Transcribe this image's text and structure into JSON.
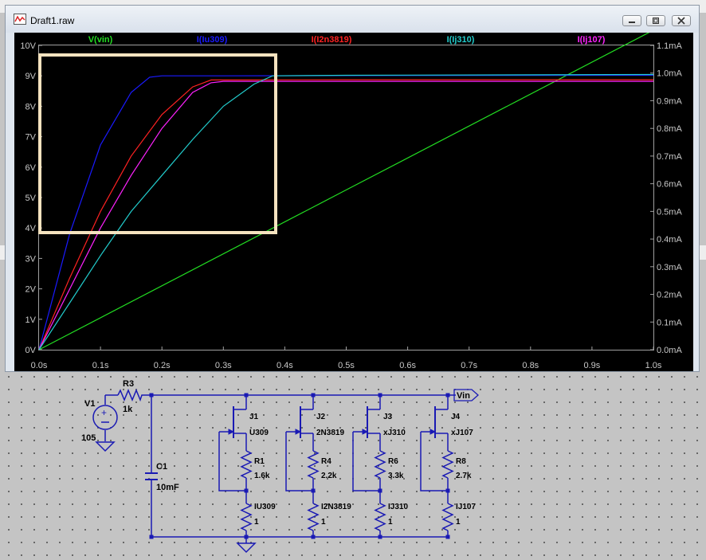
{
  "window": {
    "title": "Draft1.raw"
  },
  "plot": {
    "legend": [
      {
        "label": "V(vin)",
        "color": "#22dd22"
      },
      {
        "label": "I(Iu309)",
        "color": "#1a1aff"
      },
      {
        "label": "I(I2n3819)",
        "color": "#ff2222"
      },
      {
        "label": "I(Ij310)",
        "color": "#22cccc"
      },
      {
        "label": "I(Ij107)",
        "color": "#ff22ff"
      }
    ],
    "left_axis_ticks": [
      "0V",
      "1V",
      "2V",
      "3V",
      "4V",
      "5V",
      "6V",
      "7V",
      "8V",
      "9V",
      "10V"
    ],
    "right_axis_ticks": [
      "0.0mA",
      "0.1mA",
      "0.2mA",
      "0.3mA",
      "0.4mA",
      "0.5mA",
      "0.6mA",
      "0.7mA",
      "0.8mA",
      "0.9mA",
      "1.0mA",
      "1.1mA"
    ],
    "x_axis_ticks": [
      "0.0s",
      "0.1s",
      "0.2s",
      "0.3s",
      "0.4s",
      "0.5s",
      "0.6s",
      "0.7s",
      "0.8s",
      "0.9s",
      "1.0s"
    ],
    "highlight_color": "#f5e3bf"
  },
  "chart_data": {
    "type": "line",
    "x_unit": "s",
    "xlim": [
      0,
      1.0
    ],
    "left_ylim": [
      0,
      10
    ],
    "right_ylim": [
      0,
      1.1
    ],
    "grid": false,
    "legend_placement": "top",
    "series": [
      {
        "name": "V(vin)",
        "axis": "left",
        "color": "#22dd22",
        "x": [
          0,
          0.5,
          1.0
        ],
        "y": [
          0,
          5.25,
          10.5
        ]
      },
      {
        "name": "I(Iu309)",
        "axis": "right",
        "color": "#1a1aff",
        "x": [
          0,
          0.05,
          0.1,
          0.15,
          0.18,
          0.2,
          0.25,
          0.3,
          0.5,
          1.0
        ],
        "y": [
          0,
          0.42,
          0.74,
          0.93,
          0.985,
          0.99,
          0.99,
          0.99,
          0.991,
          0.992
        ]
      },
      {
        "name": "I(I2n3819)",
        "axis": "right",
        "color": "#ff2222",
        "x": [
          0,
          0.05,
          0.1,
          0.15,
          0.2,
          0.25,
          0.28,
          0.3,
          0.5,
          1.0
        ],
        "y": [
          0,
          0.26,
          0.5,
          0.7,
          0.85,
          0.95,
          0.975,
          0.975,
          0.976,
          0.976
        ]
      },
      {
        "name": "I(Ij107)",
        "axis": "right",
        "color": "#ff22ff",
        "x": [
          0,
          0.05,
          0.1,
          0.15,
          0.2,
          0.25,
          0.28,
          0.3,
          0.5,
          1.0
        ],
        "y": [
          0,
          0.22,
          0.44,
          0.63,
          0.8,
          0.93,
          0.965,
          0.97,
          0.97,
          0.97
        ]
      },
      {
        "name": "I(Ij310)",
        "axis": "right",
        "color": "#22cccc",
        "x": [
          0,
          0.05,
          0.1,
          0.15,
          0.2,
          0.25,
          0.3,
          0.35,
          0.38,
          0.5,
          1.0
        ],
        "y": [
          0,
          0.17,
          0.34,
          0.5,
          0.63,
          0.76,
          0.88,
          0.96,
          0.99,
          0.992,
          0.995
        ]
      }
    ]
  },
  "schematic": {
    "source": {
      "name": "V1",
      "value": "105"
    },
    "resistor_in": {
      "name": "R3",
      "value": "1k"
    },
    "capacitor": {
      "name": "C1",
      "value": "10mF"
    },
    "net_label": "Vin",
    "branches": [
      {
        "jfet": "J1",
        "model": "U309",
        "r": "R1",
        "rval": "1.6k",
        "sense": "IU309",
        "sval": "1"
      },
      {
        "jfet": "J2",
        "model": "2N3819",
        "r": "R4",
        "rval": "2.2k",
        "sense": "I2N3819",
        "sval": "1"
      },
      {
        "jfet": "J3",
        "model": "xJ310",
        "r": "R6",
        "rval": "3.3k",
        "sense": "IJ310",
        "sval": "1"
      },
      {
        "jfet": "J4",
        "model": "xJ107",
        "r": "R8",
        "rval": "2.7k",
        "sense": "IJ107",
        "sval": "1"
      }
    ]
  }
}
